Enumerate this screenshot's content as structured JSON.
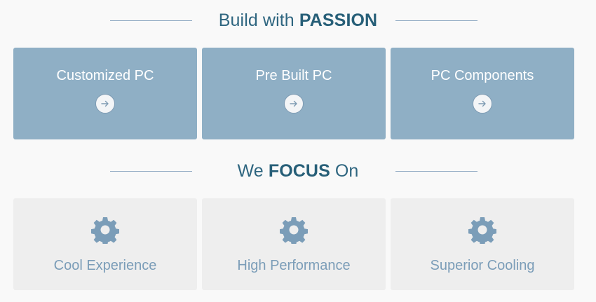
{
  "build_section": {
    "heading_prefix": "Build with",
    "heading_emphasis": "PASSION",
    "cards": [
      {
        "title": "Customized PC",
        "icon": "arrow-right-icon"
      },
      {
        "title": "Pre Built PC",
        "icon": "arrow-right-icon"
      },
      {
        "title": "PC Components",
        "icon": "arrow-right-icon"
      }
    ]
  },
  "focus_section": {
    "heading_prefix": "We",
    "heading_emphasis": "FOCUS",
    "heading_suffix": "On",
    "items": [
      {
        "label": "Cool Experience",
        "icon": "gear-icon"
      },
      {
        "label": "High Performance",
        "icon": "gear-icon"
      },
      {
        "label": "Superior Cooling",
        "icon": "gear-icon"
      }
    ]
  },
  "colors": {
    "heading": "#2f6680",
    "card_blue": "#8fafc5",
    "card_gray": "#eeeeee",
    "focus_text": "#7b9db8",
    "rule": "#8fa9c2"
  }
}
